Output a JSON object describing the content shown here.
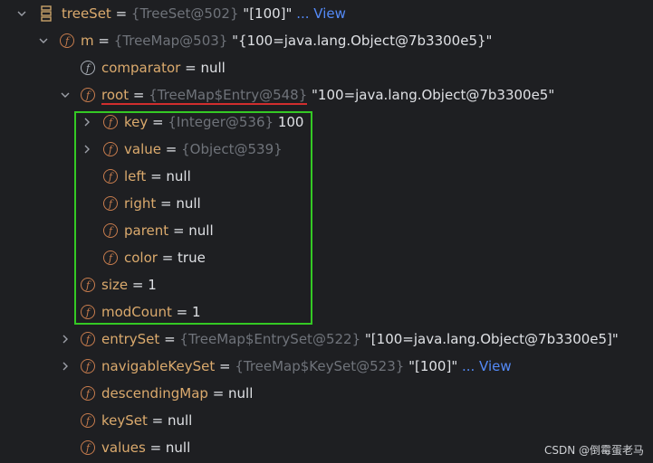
{
  "rows": [
    {
      "indent_level": 0,
      "expand": "down",
      "icon": "collection-icon",
      "name": "treeSet",
      "eq": " = ",
      "ref": "{TreeSet@502}",
      "val": " \"[100]\" ",
      "link": "... View"
    },
    {
      "indent_level": 1,
      "expand": "down",
      "icon": "field-icon",
      "name": "m",
      "eq": " = ",
      "ref": "{TreeMap@503}",
      "val": " \"{100=java.lang.Object@7b3300e5}\"",
      "link": ""
    },
    {
      "indent_level": 2,
      "expand": "none",
      "icon": "field-lock-icon",
      "name": "comparator",
      "eq": " = ",
      "ref": "",
      "val": "null",
      "link": ""
    },
    {
      "indent_level": 2,
      "expand": "down",
      "icon": "field-icon",
      "name": "root",
      "eq": " = ",
      "ref": "{TreeMap$Entry@548}",
      "val": " \"100=java.lang.Object@7b3300e5\"",
      "link": ""
    },
    {
      "indent_level": 3,
      "expand": "right",
      "icon": "field-icon",
      "name": "key",
      "eq": " = ",
      "ref": "{Integer@536}",
      "val": " 100",
      "link": ""
    },
    {
      "indent_level": 3,
      "expand": "right",
      "icon": "field-icon",
      "name": "value",
      "eq": " = ",
      "ref": "{Object@539}",
      "val": "",
      "link": ""
    },
    {
      "indent_level": 3,
      "expand": "none",
      "icon": "field-icon",
      "name": "left",
      "eq": " = ",
      "ref": "",
      "val": "null",
      "link": ""
    },
    {
      "indent_level": 3,
      "expand": "none",
      "icon": "field-icon",
      "name": "right",
      "eq": " = ",
      "ref": "",
      "val": "null",
      "link": ""
    },
    {
      "indent_level": 3,
      "expand": "none",
      "icon": "field-icon",
      "name": "parent",
      "eq": " = ",
      "ref": "",
      "val": "null",
      "link": ""
    },
    {
      "indent_level": 3,
      "expand": "none",
      "icon": "field-icon",
      "name": "color",
      "eq": " = ",
      "ref": "",
      "val": "true",
      "link": ""
    },
    {
      "indent_level": 2,
      "expand": "none",
      "icon": "field-icon",
      "name": "size",
      "eq": " = ",
      "ref": "",
      "val": "1",
      "link": ""
    },
    {
      "indent_level": 2,
      "expand": "none",
      "icon": "field-icon",
      "name": "modCount",
      "eq": " = ",
      "ref": "",
      "val": "1",
      "link": ""
    },
    {
      "indent_level": 2,
      "expand": "right",
      "icon": "field-icon",
      "name": "entrySet",
      "eq": " = ",
      "ref": "{TreeMap$EntrySet@522}",
      "val": " \"[100=java.lang.Object@7b3300e5]\"",
      "link": ""
    },
    {
      "indent_level": 2,
      "expand": "right",
      "icon": "field-icon",
      "name": "navigableKeySet",
      "eq": " = ",
      "ref": "{TreeMap$KeySet@523}",
      "val": " \"[100]\" ",
      "link": "... View"
    },
    {
      "indent_level": 2,
      "expand": "none",
      "icon": "field-icon",
      "name": "descendingMap",
      "eq": " = ",
      "ref": "",
      "val": "null",
      "link": ""
    },
    {
      "indent_level": 2,
      "expand": "none",
      "icon": "field-icon",
      "name": "keySet",
      "eq": " = ",
      "ref": "",
      "val": "null",
      "link": ""
    },
    {
      "indent_level": 2,
      "expand": "none",
      "icon": "field-icon",
      "name": "values",
      "eq": " = ",
      "ref": "",
      "val": "null",
      "link": ""
    }
  ],
  "field_icon_letter": "f",
  "watermark": "CSDN @倒霉蛋老马",
  "colors": {
    "background": "#1e1f22",
    "field_name": "#dbaa6d",
    "ref": "#6f737a",
    "link": "#548af7",
    "highlight_box": "#34c924",
    "underline": "#d12e2e"
  }
}
